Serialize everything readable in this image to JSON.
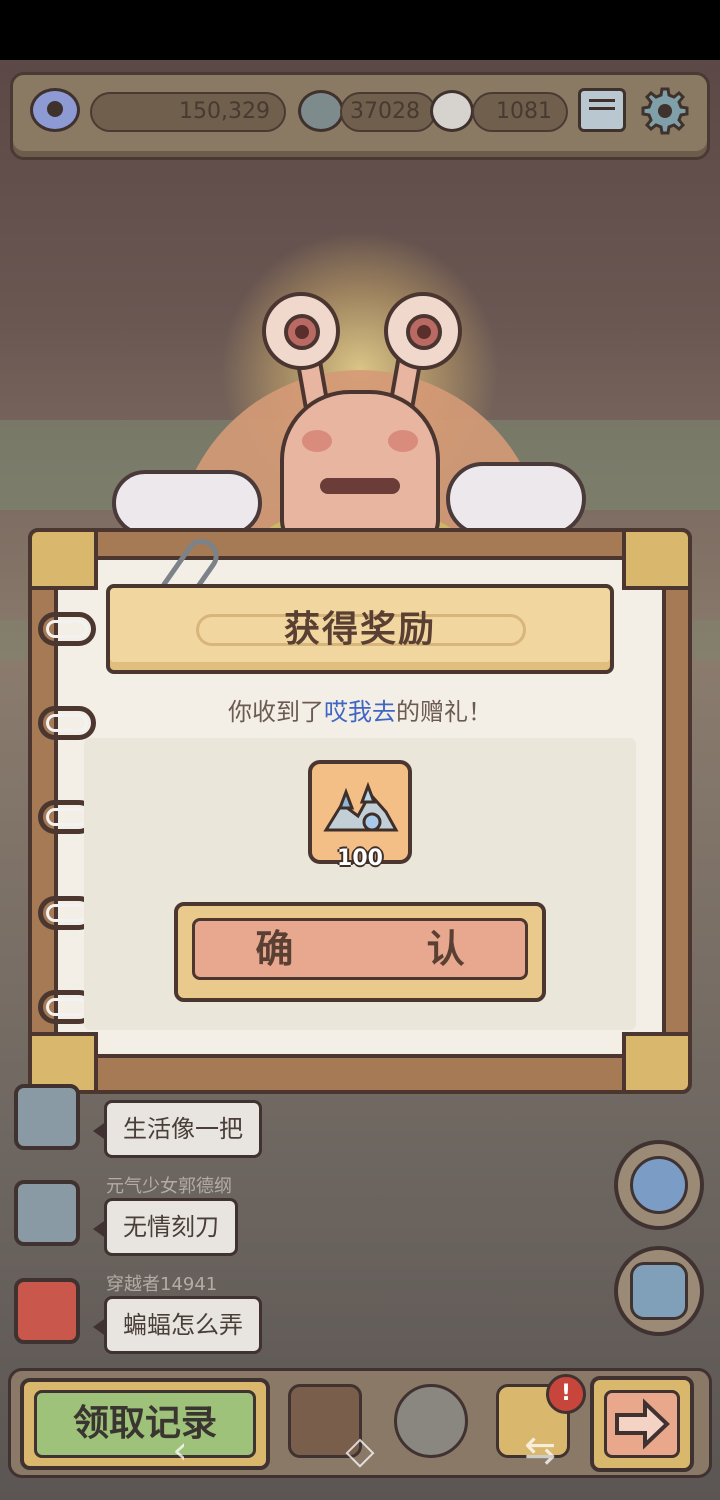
{
  "resources": {
    "eye_value": "150,329",
    "bubble_value": "37028",
    "bubble2_value": "1081"
  },
  "dialog": {
    "title": "获得奖励",
    "message_prefix": "你收到了",
    "sender_name": "哎我去",
    "message_suffix": "的赠礼！",
    "reward_count": "100",
    "confirm_label": "确 认"
  },
  "chat": [
    {
      "user": "",
      "text": "生活像一把"
    },
    {
      "user": "元气少女郭德纲",
      "text": "无情刻刀"
    },
    {
      "user": "穿越者14941",
      "text": "蝙蝠怎么弄"
    }
  ],
  "bottom_bar": {
    "records_label": "领取记录",
    "badge": "!"
  },
  "icons": {
    "eye": "eye-icon",
    "chat_bubble": "chat-bubble-icon",
    "mail": "mail-icon",
    "settings": "gear-icon",
    "reward": "crystal-pile-icon",
    "planet": "planet-icon",
    "chat": "chat-icon",
    "backpack": "backpack-icon",
    "bust": "statue-bust-icon",
    "pyramid": "pyramid-eye-icon",
    "arrow": "arrow-right-icon"
  },
  "colors": {
    "sender_name": "#3f66c4",
    "confirm_fill": "#e8a890",
    "records_fill": "#9ec27a",
    "badge": "#c8453c"
  }
}
